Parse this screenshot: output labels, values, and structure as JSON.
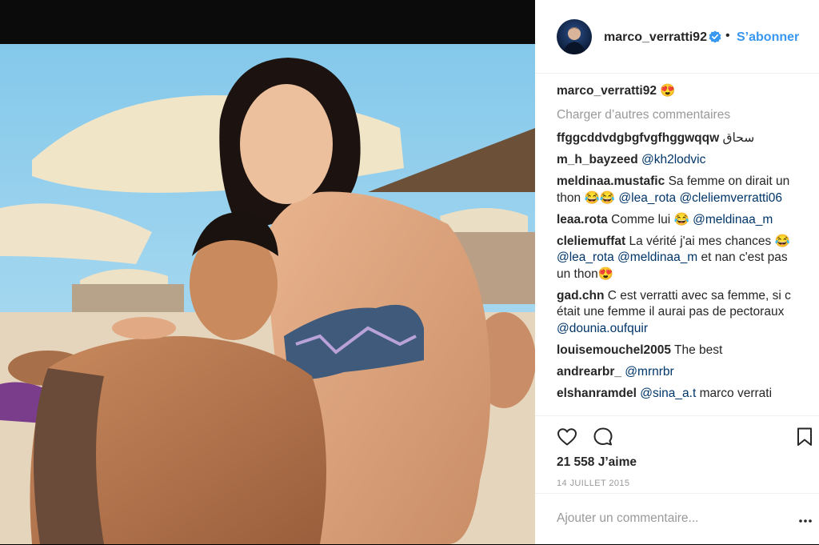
{
  "post": {
    "username": "marco_verratti92",
    "separator": "•",
    "follow_label": "S’abonner",
    "caption_emoji": "😍"
  },
  "load_more": "Charger d’autres commentaires",
  "comments": [
    {
      "user": "ffggcddvdgbgfvgfhggwqqw",
      "text": "سحاق"
    },
    {
      "user": "m_h_bayzeed",
      "text": "",
      "mention": "@kh2lodvic"
    },
    {
      "user": "meldinaa.mustafic",
      "text": "Sa femme on dirait un thon 😂😂",
      "mention": "@lea_rota @cleliemverratti06"
    },
    {
      "user": "leaa.rota",
      "text": "Comme lui 😂",
      "mention": "@meldinaa_m"
    },
    {
      "user": "cleliemuffat",
      "text": "La vérité j'ai mes chances 😂",
      "mention": "@lea_rota @meldinaa_m",
      "after": "et nan c'est pas un thon😍"
    },
    {
      "user": "gad.chn",
      "text": "C est verratti avec sa femme, si c était une femme il aurai pas de pectoraux",
      "mention": "@dounia.oufquir"
    },
    {
      "user": "louisemouchel2005",
      "text": "The best"
    },
    {
      "user": "andrearbr_",
      "text": "",
      "mention": "@mrnrbr"
    },
    {
      "user": "elshanramdel",
      "text": "",
      "mention": "@sina_a.t",
      "after": "marco verrati"
    }
  ],
  "likes": "21 558 J’aime",
  "date": "14 JUILLET 2015",
  "add_comment_placeholder": "Ajouter un commentaire...",
  "icons": {
    "like": "heart-outline-icon",
    "comment": "speech-bubble-icon",
    "save": "bookmark-icon",
    "options": "ellipsis-icon",
    "verified": "verified-badge-icon"
  },
  "colors": {
    "accent": "#3897f0",
    "mention": "#003569",
    "muted": "#999999",
    "text": "#262626"
  }
}
